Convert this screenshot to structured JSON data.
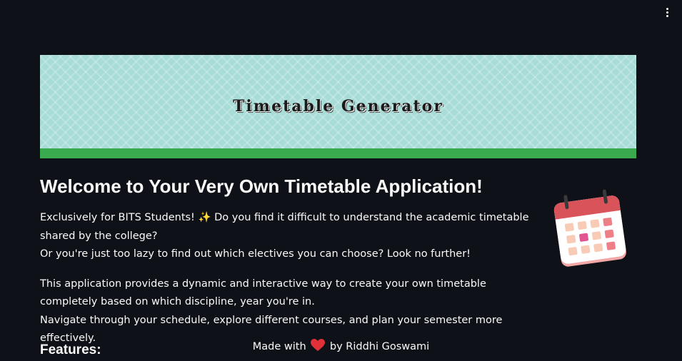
{
  "app": {
    "menu_icon": "kebab-menu-icon"
  },
  "banner": {
    "title": "Timetable Generator",
    "background_color": "#a8dcd7",
    "stripe_color": "#3aaa4f"
  },
  "main": {
    "heading": "Welcome to Your Very Own Timetable Application!",
    "paragraph1_line1": "Exclusively for BITS Students! ✨ Do you find it difficult to understand the academic timetable shared by the college?",
    "paragraph1_line2": "Or you're just too lazy to find out which electives you can choose? Look no further!",
    "paragraph2_line1": "This application provides a dynamic and interactive way to create your own timetable completely based on which discipline, year you're in.",
    "paragraph2_line2": "Navigate through your schedule, explore different courses, and plan your semester more effectively.",
    "features_heading": "Features:",
    "calendar_icon": "calendar-icon"
  },
  "footer": {
    "prefix": "Made with",
    "heart_icon": "heart-icon",
    "suffix": "by Riddhi Goswami",
    "heart_color": "#e0303a"
  }
}
